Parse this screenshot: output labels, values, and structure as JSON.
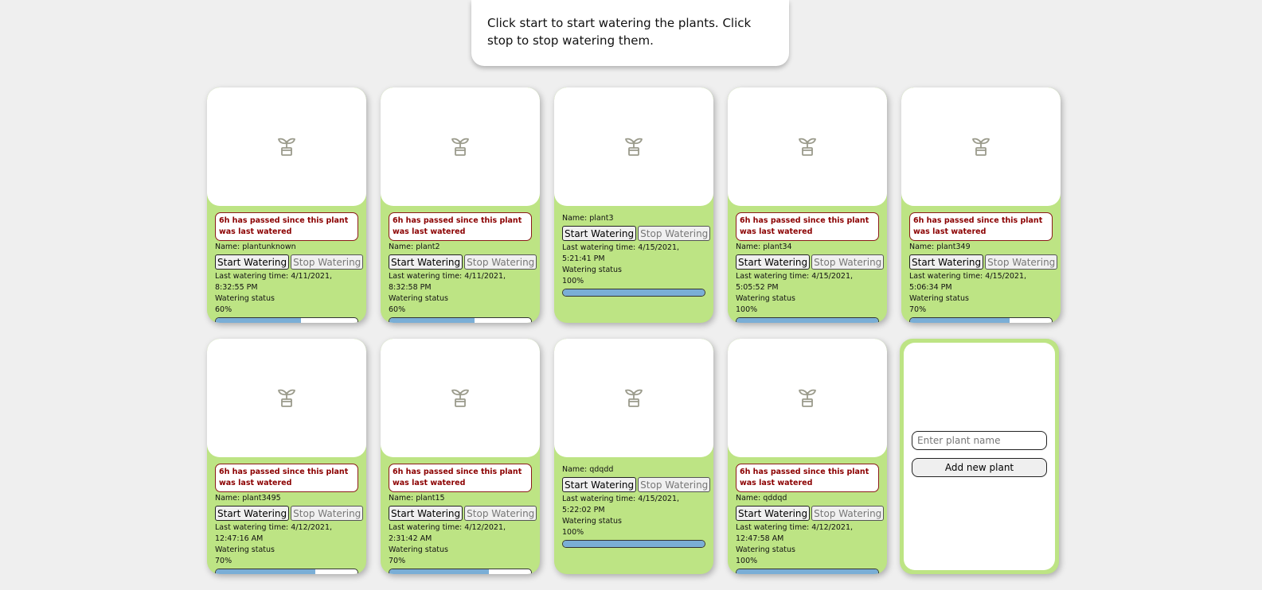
{
  "instructions": "Click start to start watering the plants. Click stop to stop watering them.",
  "labels": {
    "start_button": "Start Watering",
    "stop_button": "Stop Watering",
    "name_prefix": "Name: ",
    "last_watering_prefix": "Last watering time: ",
    "status_label": "Watering status",
    "alert_text": "6h has passed since this plant was last watered"
  },
  "colors": {
    "card_background": "#bde484",
    "alert_text": "#8b0000",
    "progress_fill": "#7aaed6"
  },
  "plants": [
    {
      "name": "plantunknown",
      "alert": true,
      "last_watering": "4/11/2021, 8:32:55 PM",
      "status": "60%",
      "progress": 0.6,
      "icon": "plant-pot-icon"
    },
    {
      "name": "plant2",
      "alert": true,
      "last_watering": "4/11/2021, 8:32:58 PM",
      "status": "60%",
      "progress": 0.6,
      "icon": "plant-pot-icon"
    },
    {
      "name": "plant3",
      "alert": false,
      "last_watering": "4/15/2021, 5:21:41 PM",
      "status": "100%",
      "progress": 1.0,
      "icon": "plant-pot-icon"
    },
    {
      "name": "plant34",
      "alert": true,
      "last_watering": "4/15/2021, 5:05:52 PM",
      "status": "100%",
      "progress": 1.0,
      "icon": "plant-pot-icon"
    },
    {
      "name": "plant349",
      "alert": true,
      "last_watering": "4/15/2021, 5:06:34 PM",
      "status": "70%",
      "progress": 0.7,
      "icon": "plant-pot-icon"
    },
    {
      "name": "plant3495",
      "alert": true,
      "last_watering": "4/12/2021, 12:47:16 AM",
      "status": "70%",
      "progress": 0.7,
      "icon": "plant-pot-icon"
    },
    {
      "name": "plant15",
      "alert": true,
      "last_watering": "4/12/2021, 2:31:42 AM",
      "status": "70%",
      "progress": 0.7,
      "icon": "plant-pot-icon"
    },
    {
      "name": "qdqdd",
      "alert": false,
      "last_watering": "4/15/2021, 5:22:02 PM",
      "status": "100%",
      "progress": 1.0,
      "icon": "plant-pot-icon"
    },
    {
      "name": "qddqd",
      "alert": true,
      "last_watering": "4/12/2021, 12:47:58 AM",
      "status": "100%",
      "progress": 1.0,
      "icon": "plant-pot-icon"
    }
  ],
  "add_plant": {
    "placeholder": "Enter plant name",
    "button_label": "Add new plant"
  }
}
